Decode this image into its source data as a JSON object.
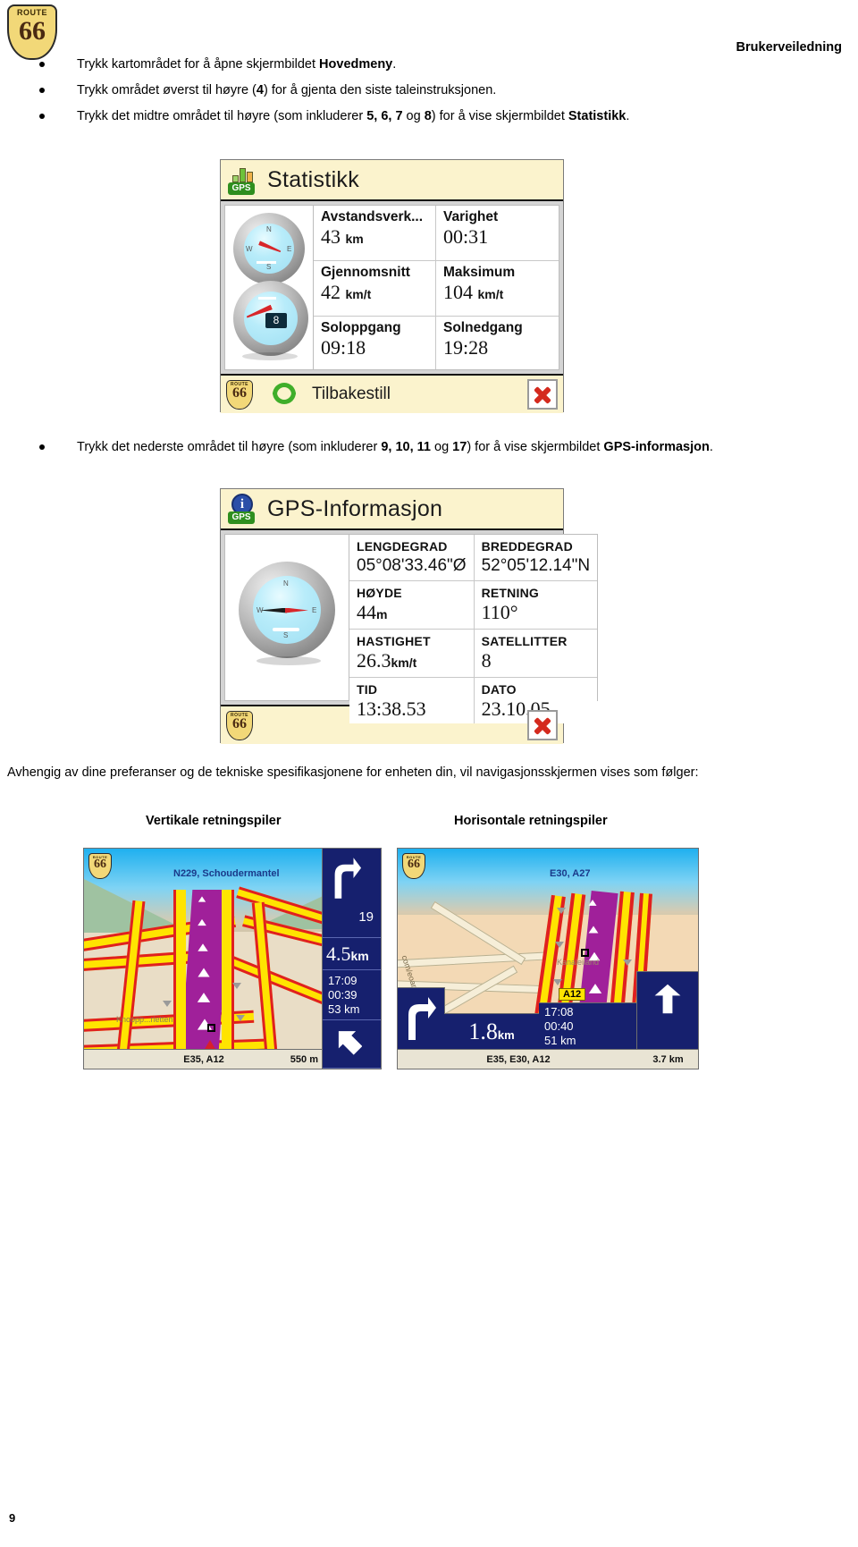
{
  "document": {
    "header_title": "Brukerveiledning",
    "page_number": "9",
    "logo": {
      "top_text": "ROUTE",
      "number": "66"
    }
  },
  "bullets": [
    {
      "id": "bullet-hovedmeny",
      "parts": [
        {
          "t": "Trykk kartområdet for å åpne skjermbildet ",
          "b": false
        },
        {
          "t": "Hovedmeny",
          "b": true
        },
        {
          "t": ".",
          "b": false
        }
      ]
    },
    {
      "id": "bullet-tale",
      "parts": [
        {
          "t": "Trykk området øverst til høyre (",
          "b": false
        },
        {
          "t": "4",
          "b": true
        },
        {
          "t": ") for å gjenta den siste taleinstruksjonen.",
          "b": false
        }
      ]
    },
    {
      "id": "bullet-statistikk",
      "parts": [
        {
          "t": "Trykk det midtre området til høyre (som inkluderer ",
          "b": false
        },
        {
          "t": "5, 6, 7",
          "b": true
        },
        {
          "t": " og ",
          "b": false
        },
        {
          "t": "8",
          "b": true
        },
        {
          "t": ") for å vise skjermbildet ",
          "b": false
        },
        {
          "t": "Statistikk",
          "b": true
        },
        {
          "t": ".",
          "b": false
        }
      ]
    },
    {
      "id": "bullet-gpsinfo",
      "parts": [
        {
          "t": "Trykk det nederste området til høyre (som inkluderer ",
          "b": false
        },
        {
          "t": "9, 10, 11",
          "b": true
        },
        {
          "t": " og ",
          "b": false
        },
        {
          "t": "17",
          "b": true
        },
        {
          "t": ") for å vise skjermbildet ",
          "b": false
        },
        {
          "t": "GPS-informasjon",
          "b": true
        },
        {
          "t": ".",
          "b": false
        }
      ]
    }
  ],
  "statistikk": {
    "title": "Statistikk",
    "title_icon": "gps-bars-icon",
    "fields": [
      {
        "label": "Avstandsverk...",
        "value": "43",
        "unit": "km"
      },
      {
        "label": "Varighet",
        "value": "00:31",
        "unit": ""
      },
      {
        "label": "Gjennomsnitt",
        "value": "42",
        "unit": "km/t"
      },
      {
        "label": "Maksimum",
        "value": "104",
        "unit": "km/t"
      },
      {
        "label": "Soloppgang",
        "value": "09:18",
        "unit": ""
      },
      {
        "label": "Solnedgang",
        "value": "19:28",
        "unit": ""
      }
    ],
    "footer": {
      "reset_label": "Tilbakestill",
      "reset_icon": "recycle-icon",
      "close_icon": "close-icon",
      "logo_icon": "route66-icon"
    },
    "compass": {
      "satellite_count": "8",
      "letters": [
        "N",
        "E",
        "S",
        "W"
      ]
    }
  },
  "gps_informasjon": {
    "title": "GPS-Informasjon",
    "title_icon": "gps-info-icon",
    "fields": [
      {
        "label": "LENGDEGRAD",
        "value": "05°08'33.46\"Ø",
        "unit": ""
      },
      {
        "label": "BREDDEGRAD",
        "value": "52°05'12.14\"N",
        "unit": ""
      },
      {
        "label": "HØYDE",
        "value": "44",
        "unit": "m"
      },
      {
        "label": "RETNING",
        "value": "110°",
        "unit": ""
      },
      {
        "label": "HASTIGHET",
        "value": "26.3",
        "unit": "km/t"
      },
      {
        "label": "SATELLITTER",
        "value": "8",
        "unit": ""
      },
      {
        "label": "TID",
        "value": "13:38.53",
        "unit": ""
      },
      {
        "label": "DATO",
        "value": "23.10.05",
        "unit": ""
      }
    ],
    "footer": {
      "close_icon": "close-icon",
      "logo_icon": "route66-icon"
    },
    "compass": {
      "letters": [
        "N",
        "E",
        "S",
        "W"
      ]
    }
  },
  "closing_paragraph": "Avhengig av dine preferanser og de tekniske spesifikasjonene for enheten din, vil navigasjonsskjermen vises som følger:",
  "captions": {
    "vertical": "Vertikale retningspiler",
    "horizontal": "Horisontale retningspiler"
  },
  "map_vertical": {
    "road_label": "N229, Schoudermantel",
    "bottom_label": "E35, A12",
    "bottom_distance": "550 m",
    "info": {
      "turn_icon": "turn-right-arrow",
      "exit_number": "19",
      "distance": "4.5",
      "distance_unit": "km",
      "arrival_time": "17:09",
      "duration": "00:39",
      "remaining": "53 km",
      "final_icon": "turn-left-arrow"
    }
  },
  "map_horizontal": {
    "road_label": "E30, A27",
    "place_label": "Kanaleiland",
    "road_badge": "A12",
    "side_label": "com/eoars",
    "bottom_label": "E35, E30, A12",
    "info": {
      "turn_icon": "turn-right-arrow",
      "distance": "1.8",
      "distance_unit": "km",
      "arrival_time": "17:08",
      "duration": "00:40",
      "remaining": "51 km",
      "final_icon": "straight-up-arrow",
      "final_distance": "3.7 km"
    }
  },
  "colors": {
    "title_bar": "#fbf3cd",
    "panel_bg": "#d4d4d4",
    "route_purple": "#a0209a",
    "road_yellow": "#ffe400",
    "road_red": "#e02020",
    "info_blue": "#16206e",
    "sky_blue": "#1fb0ef"
  }
}
